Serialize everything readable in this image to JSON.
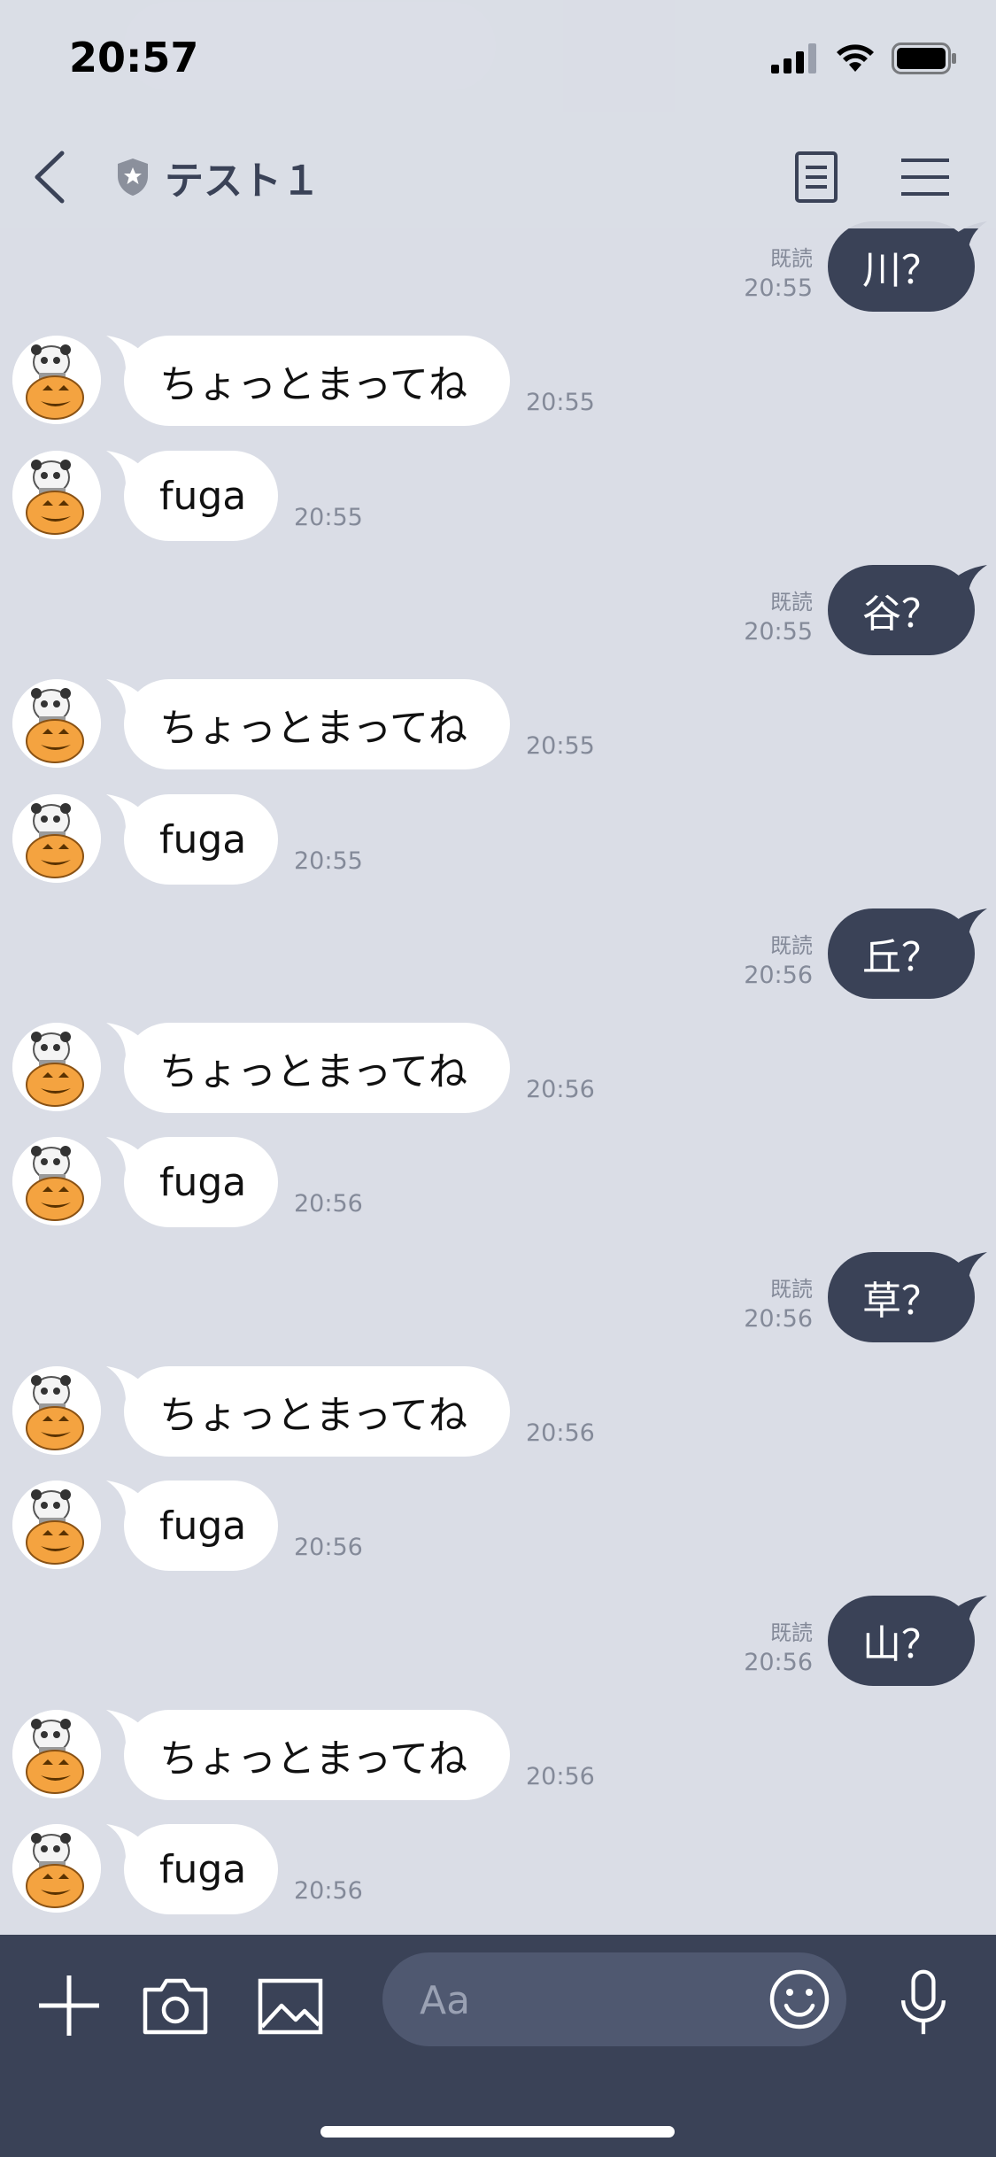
{
  "status_bar": {
    "time": "20:57",
    "icons": [
      "signal-icon",
      "wifi-icon",
      "battery-icon"
    ]
  },
  "header": {
    "room_title": "テスト１",
    "room_badge_icon": "shield-star-icon",
    "back_icon": "chevron-left-icon",
    "notes_icon": "note-icon",
    "menu_icon": "hamburger-menu-icon"
  },
  "ghost": {
    "text": "ちょっとまってね",
    "text2": "fuga",
    "time": "20:55"
  },
  "messages": [
    {
      "dir": "out",
      "text": "川？",
      "read": "既読",
      "time": "20:55"
    },
    {
      "dir": "in",
      "text": "ちょっとまってね",
      "time": "20:55"
    },
    {
      "dir": "in",
      "text": "fuga",
      "time": "20:55"
    },
    {
      "dir": "out",
      "text": "谷？",
      "read": "既読",
      "time": "20:55"
    },
    {
      "dir": "in",
      "text": "ちょっとまってね",
      "time": "20:55"
    },
    {
      "dir": "in",
      "text": "fuga",
      "time": "20:55"
    },
    {
      "dir": "out",
      "text": "丘？",
      "read": "既読",
      "time": "20:56"
    },
    {
      "dir": "in",
      "text": "ちょっとまってね",
      "time": "20:56"
    },
    {
      "dir": "in",
      "text": "fuga",
      "time": "20:56"
    },
    {
      "dir": "out",
      "text": "草？",
      "read": "既読",
      "time": "20:56"
    },
    {
      "dir": "in",
      "text": "ちょっとまってね",
      "time": "20:56"
    },
    {
      "dir": "in",
      "text": "fuga",
      "time": "20:56"
    },
    {
      "dir": "out",
      "text": "山？",
      "read": "既読",
      "time": "20:56"
    },
    {
      "dir": "in",
      "text": "ちょっとまってね",
      "time": "20:56"
    },
    {
      "dir": "in",
      "text": "fuga",
      "time": "20:56"
    }
  ],
  "composer": {
    "placeholder": "Aa",
    "tools": [
      "plus-icon",
      "camera-icon",
      "image-icon"
    ],
    "emoji_icon": "smiley-icon",
    "mic_icon": "microphone-icon"
  },
  "colors": {
    "background": "#dadde6",
    "outgoing_bubble": "#3a4257",
    "incoming_bubble": "#ffffff",
    "bottom_bar": "#3a4257",
    "meta_text": "#848a99"
  }
}
